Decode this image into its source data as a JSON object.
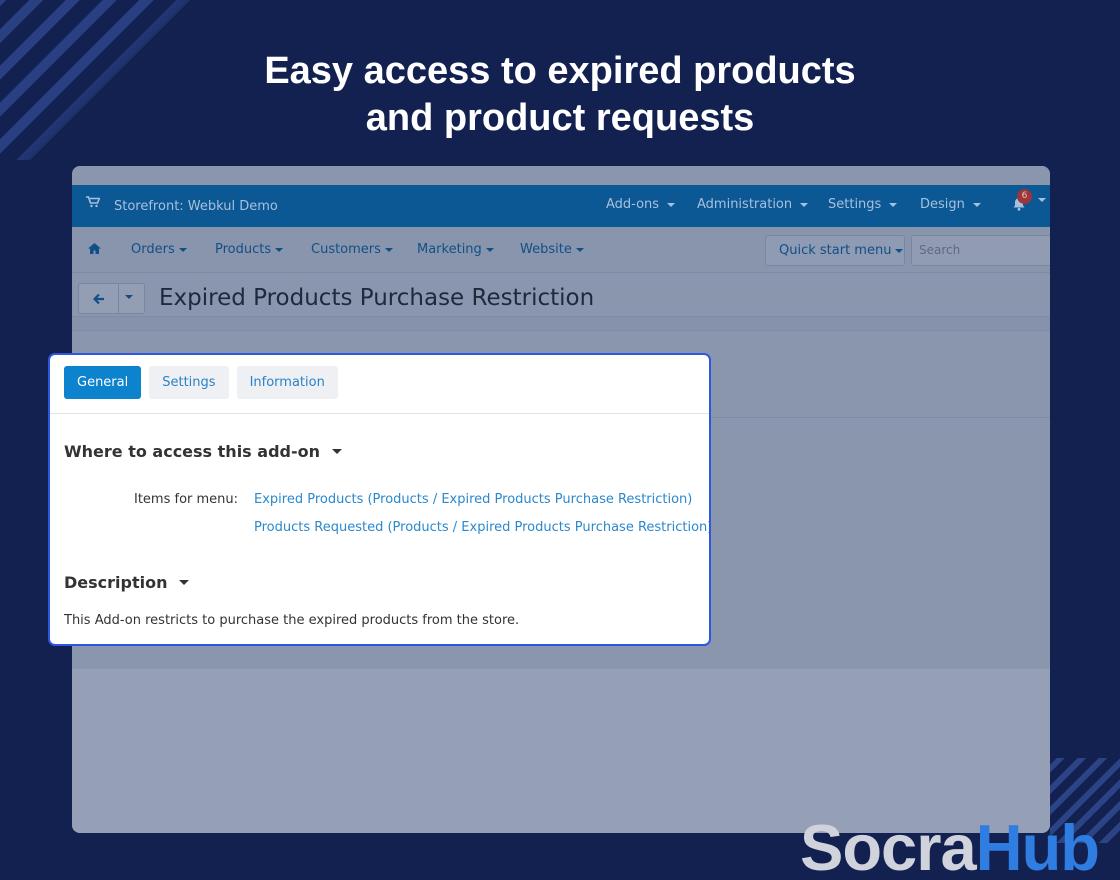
{
  "headline": {
    "line1": "Easy access to expired products",
    "line2": "and product requests"
  },
  "topbar": {
    "store_label": "Storefront: Webkul Demo",
    "nav": [
      "Add-ons",
      "Administration",
      "Settings",
      "Design"
    ],
    "notification_count": "6"
  },
  "subnav": {
    "items": [
      "Orders",
      "Products",
      "Customers",
      "Marketing",
      "Website"
    ],
    "quick_start": "Quick start menu",
    "search_placeholder": "Search"
  },
  "page": {
    "title": "Expired Products Purchase Restriction"
  },
  "panel": {
    "tabs": [
      "General",
      "Settings",
      "Information"
    ],
    "active_tab": "General",
    "section1_title": "Where to access this add-on",
    "items_label": "Items for menu:",
    "links": [
      "Expired Products (Products / Expired Products Purchase Restriction)",
      "Products Requested (Products / Expired Products Purchase Restriction)"
    ],
    "section2_title": "Description",
    "description": "This Add-on restricts to purchase the expired products from the store."
  },
  "logo": {
    "part1": "Socra",
    "part2": "Hub"
  },
  "colors": {
    "background": "#132151",
    "accent": "#0d82cd",
    "highlight_border": "#2e57e0",
    "topbar": "#0b5894"
  }
}
